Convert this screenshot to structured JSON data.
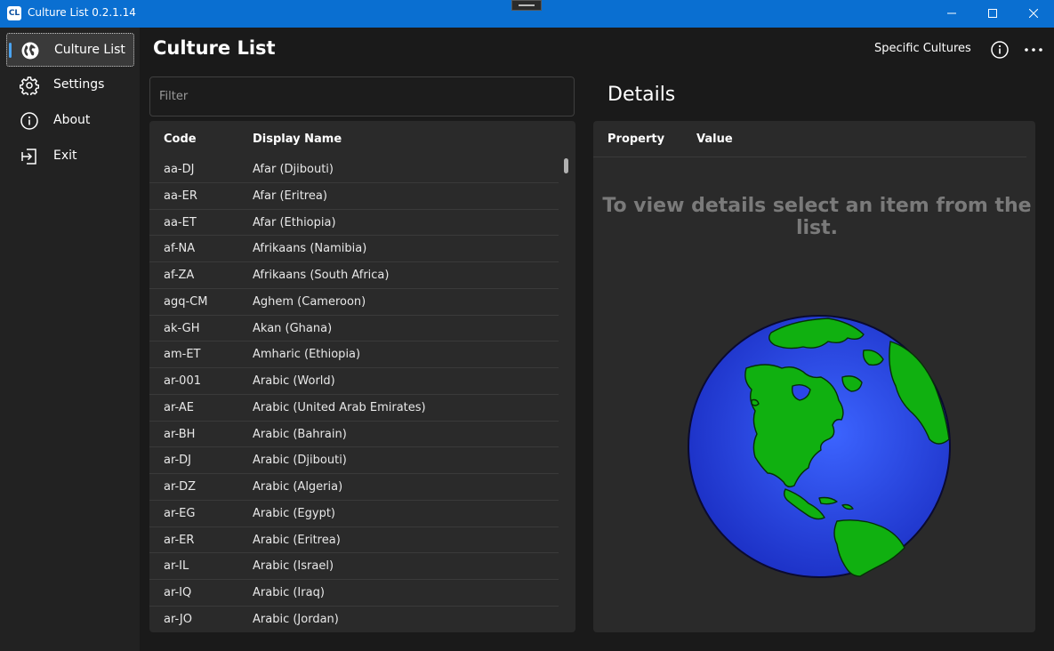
{
  "window": {
    "app_icon_text": "CL",
    "title": "Culture List  0.2.1.14"
  },
  "nav": {
    "items": [
      {
        "label": "Culture List",
        "icon": "globe-icon",
        "active": true
      },
      {
        "label": "Settings",
        "icon": "gear-icon",
        "active": false
      },
      {
        "label": "About",
        "icon": "info-icon",
        "active": false
      },
      {
        "label": "Exit",
        "icon": "exit-icon",
        "active": false
      }
    ]
  },
  "header": {
    "title": "Culture List",
    "filter_mode": "Specific Cultures"
  },
  "filter": {
    "placeholder": "Filter",
    "value": ""
  },
  "list": {
    "columns": {
      "code": "Code",
      "name": "Display Name"
    },
    "rows": [
      {
        "code": "aa-DJ",
        "name": "Afar (Djibouti)"
      },
      {
        "code": "aa-ER",
        "name": "Afar (Eritrea)"
      },
      {
        "code": "aa-ET",
        "name": "Afar (Ethiopia)"
      },
      {
        "code": "af-NA",
        "name": "Afrikaans (Namibia)"
      },
      {
        "code": "af-ZA",
        "name": "Afrikaans (South Africa)"
      },
      {
        "code": "agq-CM",
        "name": "Aghem (Cameroon)"
      },
      {
        "code": "ak-GH",
        "name": "Akan (Ghana)"
      },
      {
        "code": "am-ET",
        "name": "Amharic (Ethiopia)"
      },
      {
        "code": "ar-001",
        "name": "Arabic (World)"
      },
      {
        "code": "ar-AE",
        "name": "Arabic (United Arab Emirates)"
      },
      {
        "code": "ar-BH",
        "name": "Arabic (Bahrain)"
      },
      {
        "code": "ar-DJ",
        "name": "Arabic (Djibouti)"
      },
      {
        "code": "ar-DZ",
        "name": "Arabic (Algeria)"
      },
      {
        "code": "ar-EG",
        "name": "Arabic (Egypt)"
      },
      {
        "code": "ar-ER",
        "name": "Arabic (Eritrea)"
      },
      {
        "code": "ar-IL",
        "name": "Arabic (Israel)"
      },
      {
        "code": "ar-IQ",
        "name": "Arabic (Iraq)"
      },
      {
        "code": "ar-JO",
        "name": "Arabic (Jordan)"
      }
    ]
  },
  "details": {
    "title": "Details",
    "columns": {
      "property": "Property",
      "value": "Value"
    },
    "empty_message": "To view details select an item from the list."
  },
  "colors": {
    "accent": "#0a6fd1",
    "nav_indicator": "#4aa3f0",
    "globe_ocean": "#1f3fe0",
    "globe_land": "#10b010"
  }
}
